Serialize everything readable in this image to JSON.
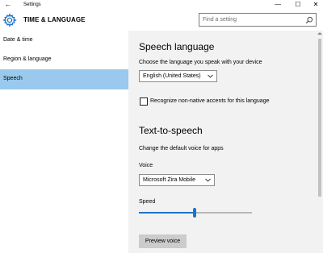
{
  "window": {
    "back_glyph": "←",
    "title": "Settings",
    "minimize_glyph": "—",
    "maximize_glyph": "☐",
    "close_glyph": "✕"
  },
  "header": {
    "icon": "gear-icon",
    "section_title": "TIME & LANGUAGE",
    "search_placeholder": "Find a setting",
    "search_icon": "search-icon"
  },
  "sidebar": {
    "items": [
      {
        "label": "Date & time",
        "active": false
      },
      {
        "label": "Region & language",
        "active": false
      },
      {
        "label": "Speech",
        "active": true
      }
    ]
  },
  "speech_language": {
    "heading": "Speech language",
    "choose_label": "Choose the language you speak with your device",
    "language_value": "English (United States)",
    "accent_checkbox_label": "Recognize non-native accents for this language",
    "accent_checked": false
  },
  "text_to_speech": {
    "heading": "Text-to-speech",
    "description": "Change the default voice for apps",
    "voice_label": "Voice",
    "voice_value": "Microsoft Zira Mobile",
    "speed_label": "Speed",
    "speed_fraction": 0.49,
    "preview_button": "Preview voice"
  },
  "colors": {
    "accent": "#1f73c7",
    "selected_nav": "#99c9ec",
    "content_bg": "#f2f2f2",
    "button_bg": "#cccccc"
  }
}
